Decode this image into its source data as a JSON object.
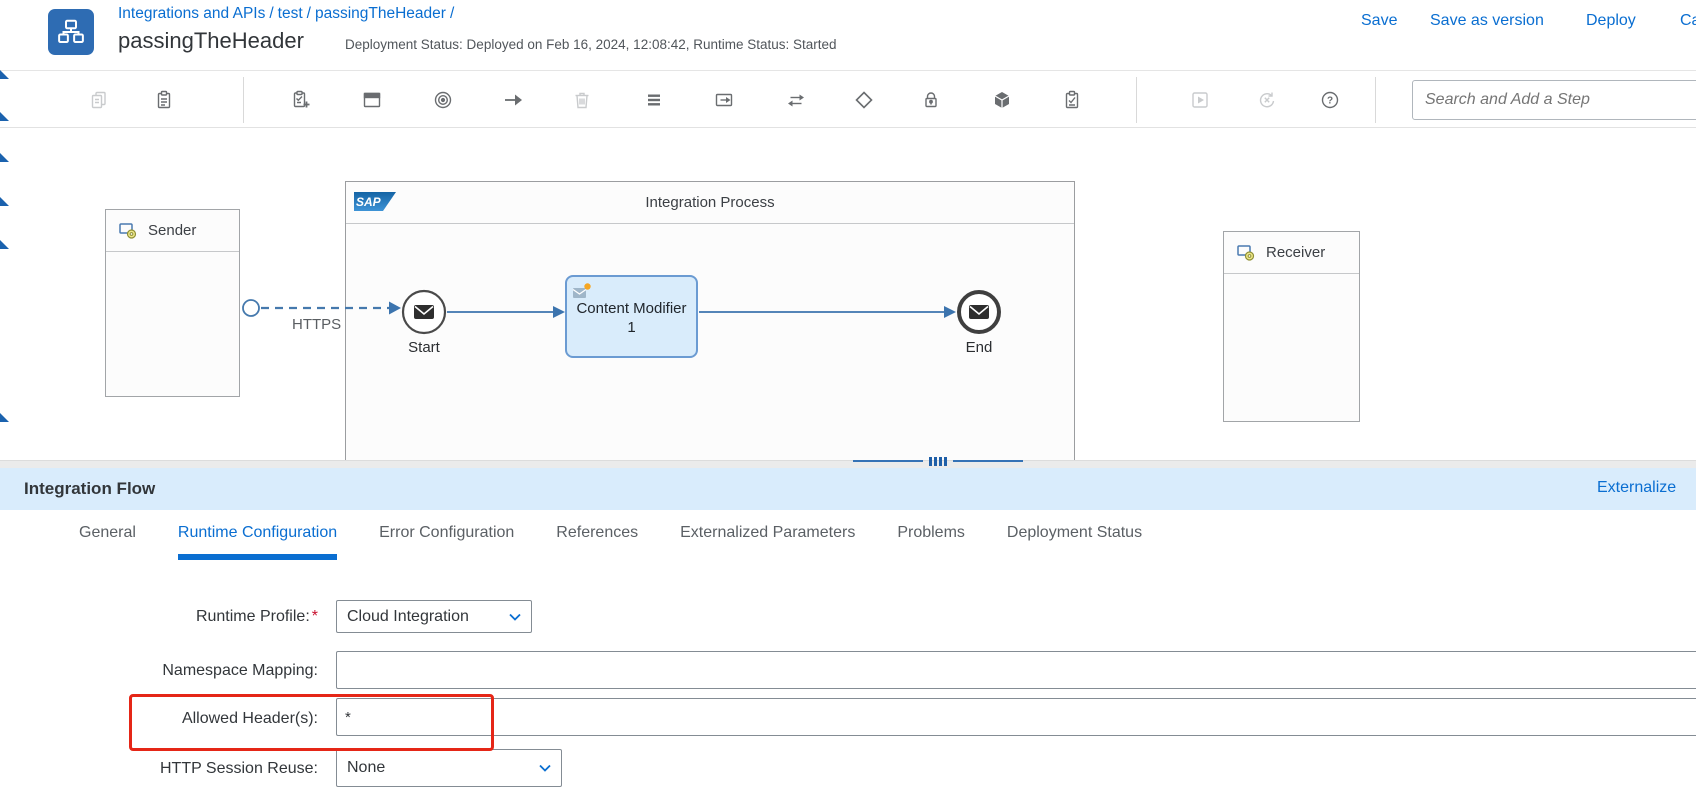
{
  "header": {
    "breadcrumb": [
      "Integrations and APIs",
      "test",
      "passingTheHeader"
    ],
    "separator": "/",
    "title": "passingTheHeader",
    "status": "Deployment Status: Deployed on Feb 16, 2024, 12:08:42, Runtime Status: Started",
    "actions": {
      "save": "Save",
      "save_as_version": "Save as version",
      "deploy": "Deploy",
      "clipped": "Cancel"
    }
  },
  "toolbar": {
    "search_placeholder": "Search and Add a Step",
    "icons": [
      "copy-icon",
      "paste-icon",
      "add-step-icon",
      "participant-icon",
      "target-icon",
      "move-arrow-icon",
      "delete-icon",
      "process-icon",
      "external-call-icon",
      "data-transform-icon",
      "router-icon",
      "security-lock-icon",
      "software-package-icon",
      "checklist-icon",
      "simulate-play-icon",
      "restart-icon",
      "help-icon"
    ]
  },
  "canvas": {
    "sender": {
      "label": "Sender"
    },
    "receiver": {
      "label": "Receiver"
    },
    "process": {
      "logo": "SAP",
      "title": "Integration Process"
    },
    "connection": {
      "protocol": "HTTPS"
    },
    "nodes": {
      "start": "Start",
      "content_modifier_line1": "Content Modifier",
      "content_modifier_line2": "1",
      "end": "End"
    }
  },
  "panel": {
    "title": "Integration Flow",
    "externalize": "Externalize",
    "tabs": [
      {
        "label": "General",
        "active": false
      },
      {
        "label": "Runtime Configuration",
        "active": true
      },
      {
        "label": "Error Configuration",
        "active": false
      },
      {
        "label": "References",
        "active": false
      },
      {
        "label": "Externalized Parameters",
        "active": false
      },
      {
        "label": "Problems",
        "active": false
      },
      {
        "label": "Deployment Status",
        "active": false
      }
    ],
    "form": {
      "runtime_profile": {
        "label": "Runtime Profile:",
        "required_mark": "*",
        "value": "Cloud Integration"
      },
      "namespace_mapping": {
        "label": "Namespace Mapping:",
        "value": ""
      },
      "allowed_headers": {
        "label": "Allowed Header(s):",
        "value": "*"
      },
      "http_session_reuse": {
        "label": "HTTP Session Reuse:",
        "value": "None"
      }
    }
  },
  "colors": {
    "accent": "#0a6ed1",
    "panel_bar": "#d9ecfc",
    "annotation_red": "#e52617",
    "node_fill": "#d9ecfb",
    "node_border": "#6b9bd2",
    "app_icon": "#2e6cb3"
  }
}
